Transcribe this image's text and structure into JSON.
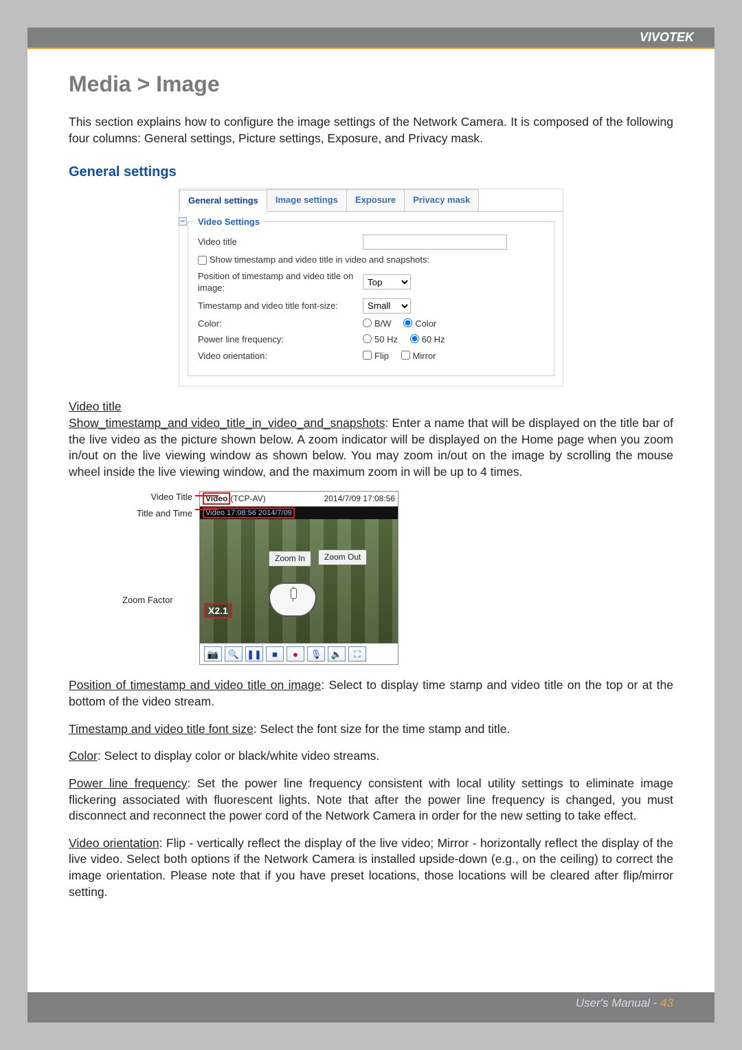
{
  "brand": "VIVOTEK",
  "page_number": "43",
  "footer_prefix": "User's Manual - ",
  "section_title": "Media > Image",
  "intro": "This section explains how to configure the image settings of the Network Camera. It is composed of the following four columns: General settings, Picture settings, Exposure, and Privacy mask.",
  "subhead": "General settings",
  "tabs": {
    "general": "General settings",
    "image": "Image settings",
    "exposure": "Exposure",
    "privacy": "Privacy mask"
  },
  "fieldset_legend": "Video Settings",
  "fieldset_minus": "−",
  "fields": {
    "video_title_label": "Video title",
    "video_title_value": "",
    "show_timestamp_label": "Show timestamp and video title in video and snapshots:",
    "position_label": "Position of timestamp and video title on image:",
    "position_value": "Top",
    "fontsize_label": "Timestamp and video title font-size:",
    "fontsize_value": "Small",
    "color_label": "Color:",
    "color_bw": "B/W",
    "color_color": "Color",
    "plf_label": "Power line frequency:",
    "plf_50": "50 Hz",
    "plf_60": "60 Hz",
    "orient_label": "Video orientation:",
    "orient_flip": "Flip",
    "orient_mirror": "Mirror"
  },
  "diagram": {
    "lbl_video_title": "Video Title",
    "lbl_title_time": "Title and Time",
    "lbl_zoom_factor": "Zoom Factor",
    "top_left_bold": "Video",
    "top_left_rest": "(TCP-AV)",
    "top_right": "2014/7/09 17:08:56",
    "sub_text": "Video 17:08:56 2014/7/09",
    "zoom_in": "Zoom In",
    "zoom_out": "Zoom Out",
    "zoom_factor": "X2.1"
  },
  "toolbar_icons": {
    "snapshot": "📷",
    "zoom": "🔍",
    "pause": "❚❚",
    "stop": "■",
    "record": "●",
    "mic": "🎙",
    "speaker": "🔈",
    "fullscreen": "⛶"
  },
  "body": {
    "video_title_head": "Video title",
    "p1_underline": "Show_timestamp_and video_title_in_video_and_snapshots",
    "p1_rest": ": Enter a name that will be displayed on the title bar of the live video as the picture shown below. A zoom indicator will be displayed on the Home page when you zoom in/out on the live viewing window as shown below. You may zoom in/out on the image by scrolling the mouse wheel inside the live viewing window, and the maximum zoom in will be up to 4 times.",
    "p2_underline": "Position of timestamp and video title on image",
    "p2_rest": ": Select to display time stamp and video title on the top or at the bottom of the video stream.",
    "p3_underline": "Timestamp and video title font size",
    "p3_rest": ": Select the font size for the time stamp and title.",
    "p4_underline": "Color",
    "p4_rest": ": Select to display color or black/white video streams.",
    "p5_underline": "Power line frequency",
    "p5_rest": ": Set the power line frequency consistent with local utility settings to eliminate image flickering associated with fluorescent lights. Note that after the power line frequency is changed, you must disconnect and reconnect the power cord of the Network Camera in order for the new setting to take effect.",
    "p6_underline": "Video orientation",
    "p6_rest": ": Flip - vertically reflect the display of the live video; Mirror - horizontally reflect the display of the live video. Select both options if the Network Camera is installed upside-down (e.g., on the ceiling) to correct the image orientation. Please note that if you have preset locations, those locations will be cleared after flip/mirror setting."
  }
}
